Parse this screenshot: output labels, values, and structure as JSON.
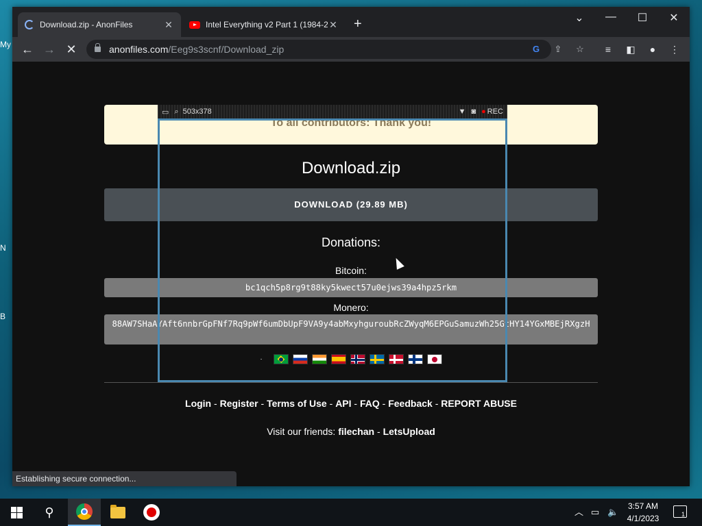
{
  "desktop": {
    "labels": [
      "My",
      "N",
      "B"
    ]
  },
  "browser": {
    "tabs": [
      {
        "title": "Download.zip - AnonFiles",
        "active": true
      },
      {
        "title": "Intel Everything v2 Part 1 (1984-2",
        "active": false
      }
    ],
    "url_domain": "anonfiles.com",
    "url_path": "/Eeg9s3scnf/Download_zip",
    "status": "Establishing secure connection..."
  },
  "page": {
    "banner": "To all contributors: Thank you!",
    "file_title": "Download.zip",
    "download_label": "DOWNLOAD (29.89 MB)",
    "donations_title": "Donations:",
    "bitcoin_label": "Bitcoin:",
    "bitcoin_address": "bc1qch5p8rg9t88ky5kwect57u0ejws39a4hpz5rkm",
    "monero_label": "Monero:",
    "monero_address": "88AW7SHaAYAft6nnbrGpFNf7Rq9pWf6umDbUpF9VA9y4abMxyhguroubRcZWyqM6EPGuSamuzWh25GtHY14YGxMBEjRXgzH",
    "flags": [
      "brazil",
      "russia",
      "india",
      "spain",
      "norway",
      "sweden",
      "denmark",
      "finland",
      "japan"
    ],
    "footer_links": [
      "Login",
      "Register",
      "Terms of Use",
      "API",
      "FAQ",
      "Feedback",
      "REPORT ABUSE"
    ],
    "friends_prefix": "Visit our friends:",
    "friends": [
      "filechan",
      "LetsUpload"
    ]
  },
  "recorder": {
    "size": "503x378",
    "rec_label": "REC"
  },
  "taskbar": {
    "time": "3:57 AM",
    "date": "4/1/2023",
    "notifications": "1"
  }
}
